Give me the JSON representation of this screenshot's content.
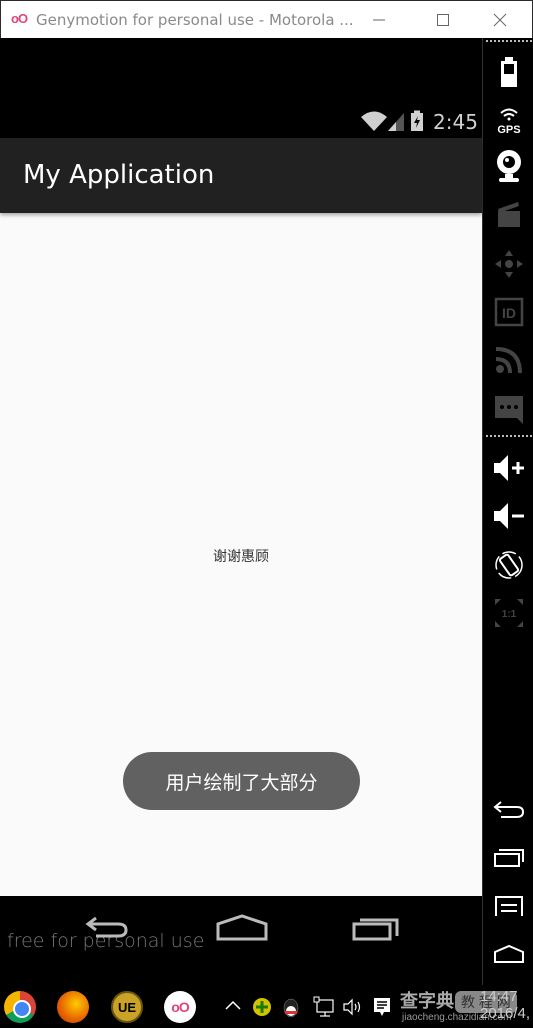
{
  "window": {
    "logo": "oO",
    "title": "Genymotion for personal use - Motorola ...",
    "minimize_label": "minimize",
    "maximize_label": "maximize",
    "close_label": "close"
  },
  "status_bar": {
    "time": "2:45"
  },
  "app_bar": {
    "title": "My Application"
  },
  "content": {
    "center_text": "谢谢惠顾",
    "toast": "用户绘制了大部分"
  },
  "nav_bar": {
    "watermark": "free for personal use"
  },
  "sidebar": {
    "gps_label": "GPS",
    "id_label": "ID",
    "pixel_perfect_label": "1:1"
  },
  "taskbar": {
    "ue_label": "UE",
    "geny_label": "oO",
    "clock_time": "14:47",
    "clock_date": "2016/4,",
    "watermark_text": "查字典",
    "watermark_badge": "教 程 网",
    "watermark_url": "jiaocheng.chazidian.com"
  }
}
